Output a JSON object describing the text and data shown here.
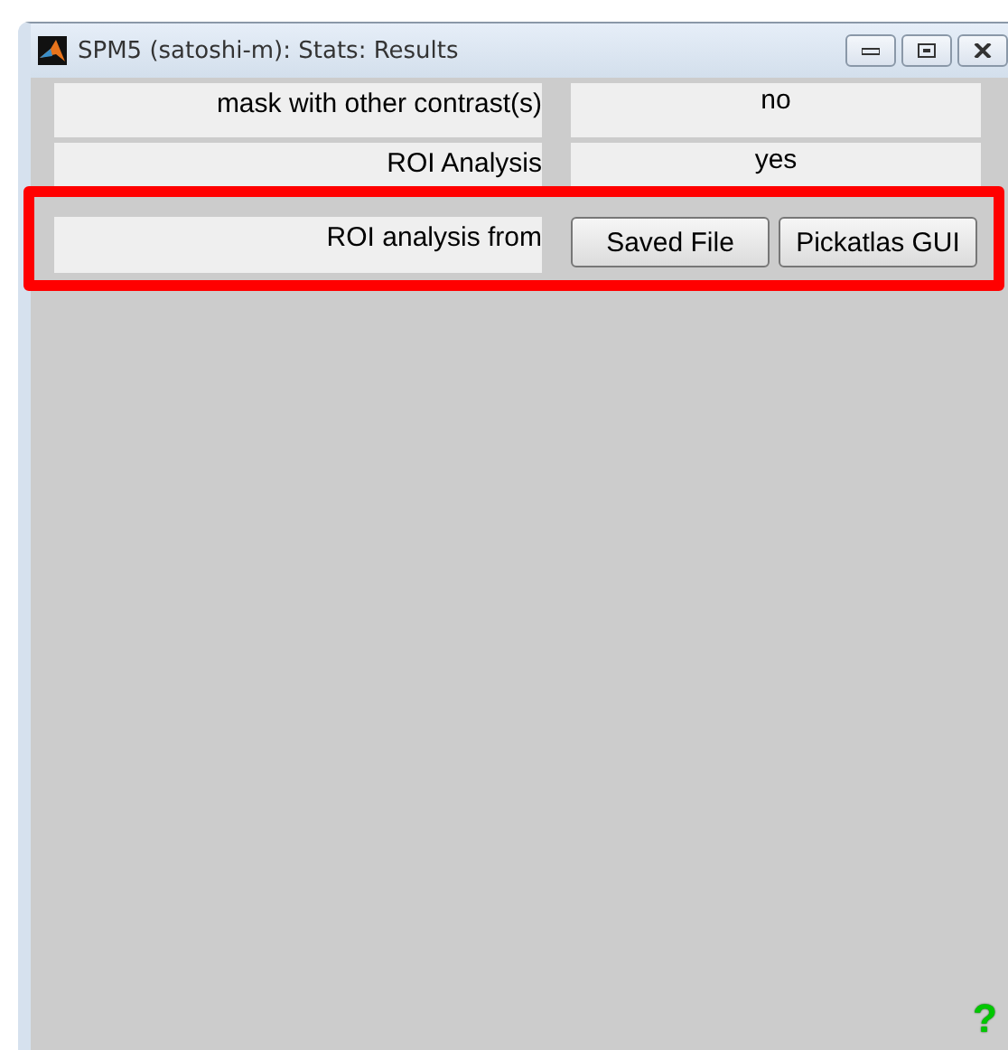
{
  "window": {
    "title": "SPM5 (satoshi-m): Stats: Results"
  },
  "rows": [
    {
      "kind": "text",
      "label": "mask with other contrast(s)",
      "value": "no"
    },
    {
      "kind": "text",
      "label": "ROI Analysis",
      "value": "yes"
    },
    {
      "kind": "buttons",
      "label": "ROI analysis from",
      "buttons": [
        "Saved File",
        "Pickatlas GUI"
      ]
    }
  ],
  "help": "?"
}
